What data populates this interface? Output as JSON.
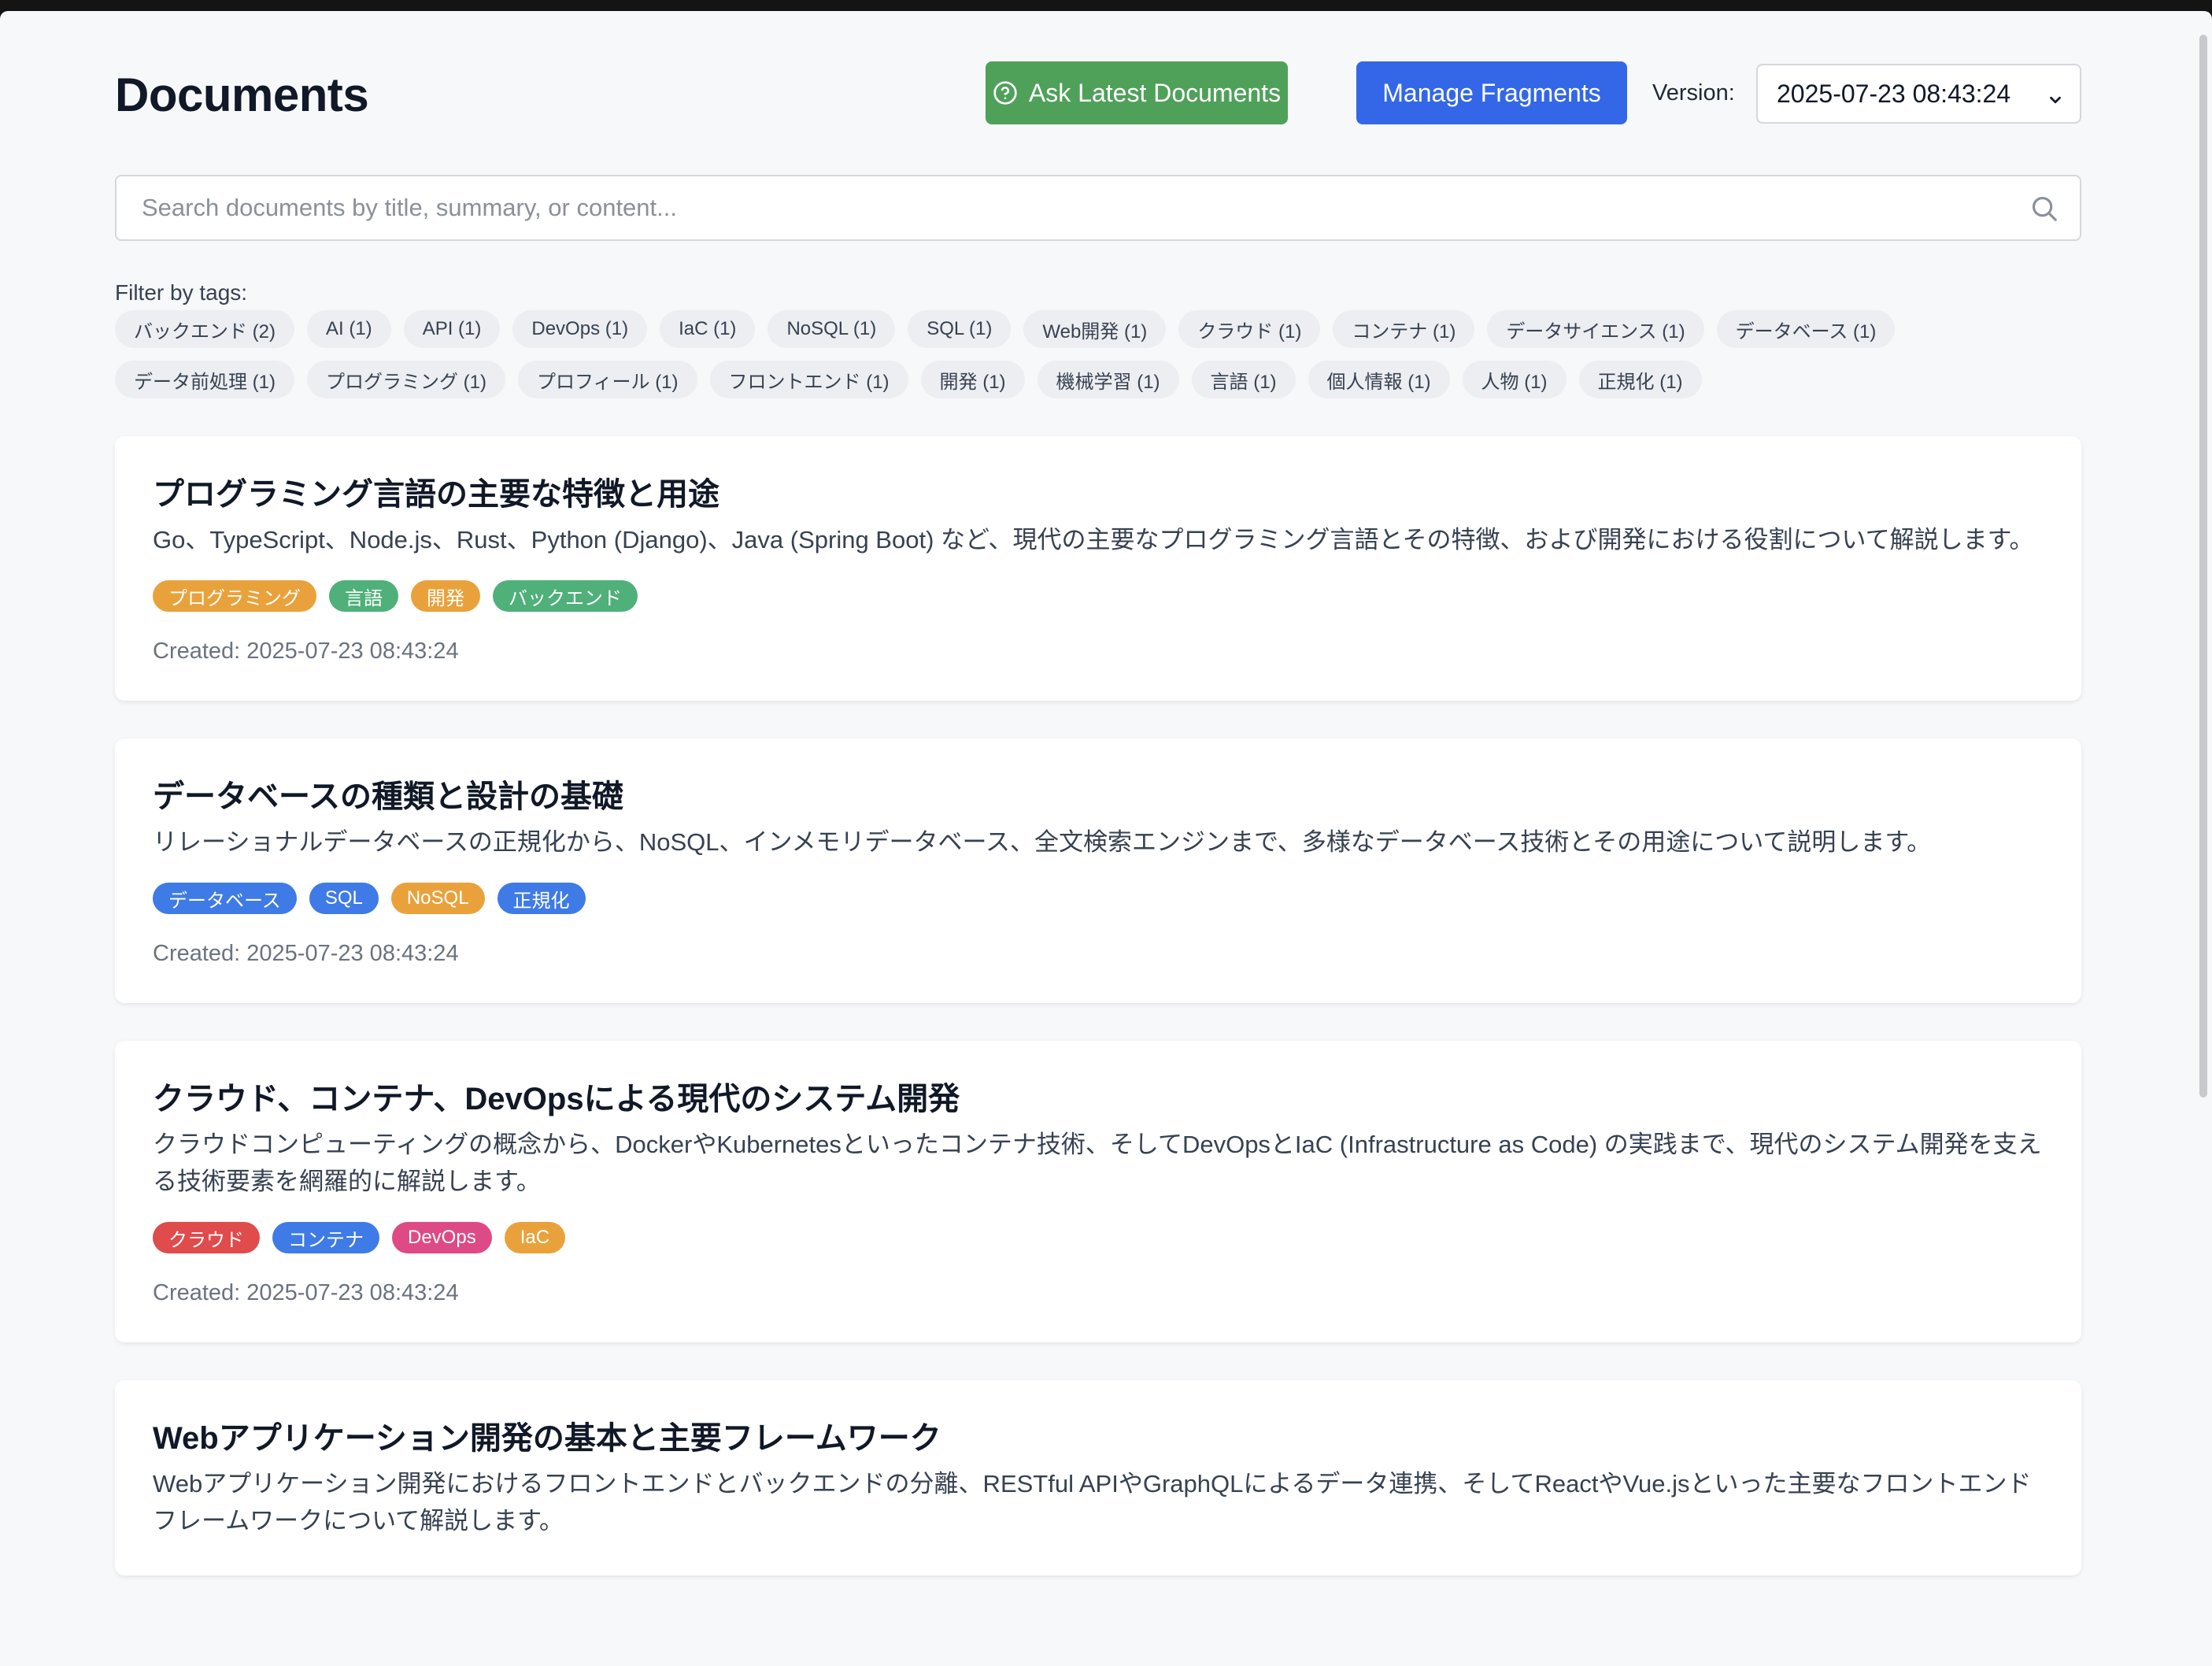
{
  "header": {
    "title": "Documents",
    "ask_label": "Ask Latest Documents",
    "manage_label": "Manage Fragments",
    "version_label": "Version:",
    "version_value": "2025-07-23 08:43:24"
  },
  "search": {
    "placeholder": "Search documents by title, summary, or content..."
  },
  "filter": {
    "label": "Filter by tags:",
    "tags": [
      "バックエンド (2)",
      "AI (1)",
      "API (1)",
      "DevOps (1)",
      "IaC (1)",
      "NoSQL (1)",
      "SQL (1)",
      "Web開発 (1)",
      "クラウド (1)",
      "コンテナ (1)",
      "データサイエンス (1)",
      "データベース (1)",
      "データ前処理 (1)",
      "プログラミング (1)",
      "プロフィール (1)",
      "フロントエンド (1)",
      "開発 (1)",
      "機械学習 (1)",
      "言語 (1)",
      "個人情報 (1)",
      "人物 (1)",
      "正規化 (1)"
    ]
  },
  "colors": {
    "ask_button": "#4fa159",
    "manage_button": "#3367e8",
    "tag_orange": "#e9a23b",
    "tag_green": "#4fb07a",
    "tag_blue": "#3f7be6",
    "tag_red": "#e04b4b",
    "tag_pink": "#de4a85"
  },
  "documents": [
    {
      "title": "プログラミング言語の主要な特徴と用途",
      "summary": "Go、TypeScript、Node.js、Rust、Python (Django)、Java (Spring Boot) など、現代の主要なプログラミング言語とその特徴、および開発における役割について解説します。",
      "tags": [
        {
          "label": "プログラミング",
          "color": "#e9a23b"
        },
        {
          "label": "言語",
          "color": "#4fb07a"
        },
        {
          "label": "開発",
          "color": "#e9a23b"
        },
        {
          "label": "バックエンド",
          "color": "#4fb07a"
        }
      ],
      "created": "Created: 2025-07-23 08:43:24"
    },
    {
      "title": "データベースの種類と設計の基礎",
      "summary": "リレーショナルデータベースの正規化から、NoSQL、インメモリデータベース、全文検索エンジンまで、多様なデータベース技術とその用途について説明します。",
      "tags": [
        {
          "label": "データベース",
          "color": "#3f7be6"
        },
        {
          "label": "SQL",
          "color": "#3f7be6"
        },
        {
          "label": "NoSQL",
          "color": "#e9a23b"
        },
        {
          "label": "正規化",
          "color": "#3f7be6"
        }
      ],
      "created": "Created: 2025-07-23 08:43:24"
    },
    {
      "title": "クラウド、コンテナ、DevOpsによる現代のシステム開発",
      "summary": "クラウドコンピューティングの概念から、DockerやKubernetesといったコンテナ技術、そしてDevOpsとIaC (Infrastructure as Code) の実践まで、現代のシステム開発を支える技術要素を網羅的に解説します。",
      "tags": [
        {
          "label": "クラウド",
          "color": "#e04b4b"
        },
        {
          "label": "コンテナ",
          "color": "#3f7be6"
        },
        {
          "label": "DevOps",
          "color": "#de4a85"
        },
        {
          "label": "IaC",
          "color": "#e9a23b"
        }
      ],
      "created": "Created: 2025-07-23 08:43:24"
    },
    {
      "title": "Webアプリケーション開発の基本と主要フレームワーク",
      "summary": "Webアプリケーション開発におけるフロントエンドとバックエンドの分離、RESTful APIやGraphQLによるデータ連携、そしてReactやVue.jsといった主要なフロントエンドフレームワークについて解説します。",
      "tags": [],
      "created": ""
    }
  ]
}
